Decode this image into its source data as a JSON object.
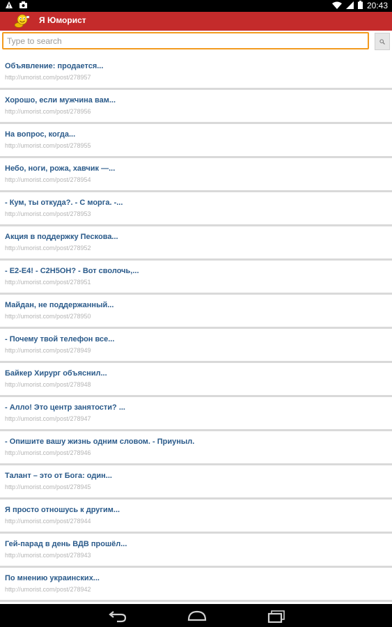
{
  "status_bar": {
    "time": "20:43",
    "left_icons": [
      "warning-icon",
      "camera-icon"
    ],
    "right_icons": [
      "wifi-icon",
      "signal-icon",
      "battery-icon"
    ]
  },
  "action_bar": {
    "title": "Я Юморист",
    "color": "#c42b2b"
  },
  "search": {
    "placeholder": "Type to search",
    "value": "",
    "accent": "#f39a1e"
  },
  "items": [
    {
      "title": "Объявление: продается...",
      "url": "http://umorist.com/post/278957"
    },
    {
      "title": "Хорошо, если мужчина вам...",
      "url": "http://umorist.com/post/278956"
    },
    {
      "title": "На вопрос, когда...",
      "url": "http://umorist.com/post/278955"
    },
    {
      "title": "Небо, ноги, рожа, хавчик —...",
      "url": "http://umorist.com/post/278954"
    },
    {
      "title": "- Кум, ты откуда?. - С морга. -...",
      "url": "http://umorist.com/post/278953"
    },
    {
      "title": "Акция в поддержку Пескова...",
      "url": "http://umorist.com/post/278952"
    },
    {
      "title": "- Е2-Е4! - С2Н5ОН? - Вот сволочь,...",
      "url": "http://umorist.com/post/278951"
    },
    {
      "title": "Майдан, не поддержанный...",
      "url": "http://umorist.com/post/278950"
    },
    {
      "title": "- Почему твой телефон все...",
      "url": "http://umorist.com/post/278949"
    },
    {
      "title": "Байкер Хирург объяснил...",
      "url": "http://umorist.com/post/278948"
    },
    {
      "title": "- Алло! Это центр занятости? ...",
      "url": "http://umorist.com/post/278947"
    },
    {
      "title": "- Опишите вашу жизнь одним словом. - Приуныл.",
      "url": "http://umorist.com/post/278946"
    },
    {
      "title": "Талант – это от Бога: один...",
      "url": "http://umorist.com/post/278945"
    },
    {
      "title": "Я просто отношусь к другим...",
      "url": "http://umorist.com/post/278944"
    },
    {
      "title": "Гей-парад в день ВДВ прошёл...",
      "url": "http://umorist.com/post/278943"
    },
    {
      "title": "По мнению украинских...",
      "url": "http://umorist.com/post/278942"
    }
  ],
  "nav_bar": {
    "buttons": [
      "back-icon",
      "home-icon",
      "recents-icon"
    ]
  }
}
